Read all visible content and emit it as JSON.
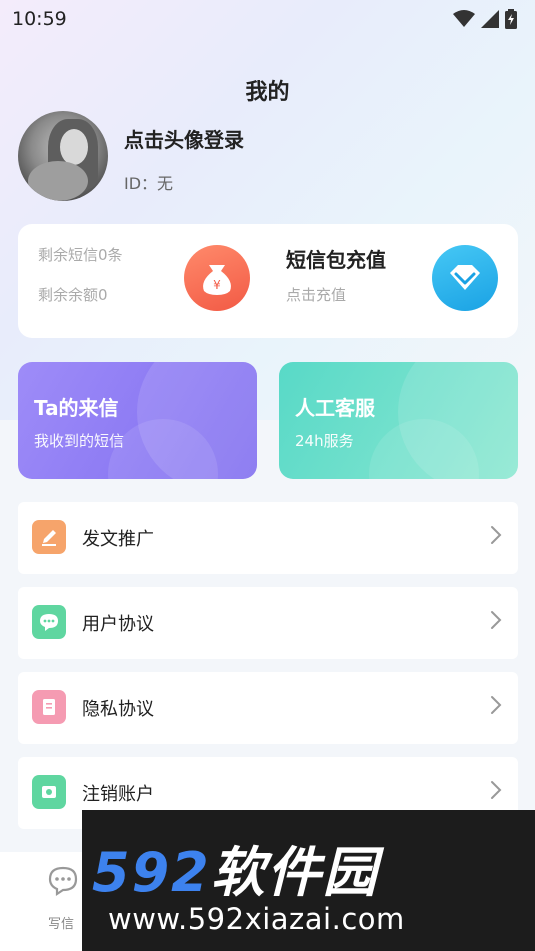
{
  "status": {
    "time": "10:59"
  },
  "page": {
    "title": "我的"
  },
  "profile": {
    "login_prompt": "点击头像登录",
    "id_line": "ID：无"
  },
  "balance": {
    "remaining_sms": "剩余短信0条",
    "remaining_amount": "剩余余额0",
    "money_symbol": "¥",
    "recharge_title": "短信包充值",
    "recharge_sub": "点击充值"
  },
  "tiles": [
    {
      "title": "Ta的来信",
      "subtitle": "我收到的短信"
    },
    {
      "title": "人工客服",
      "subtitle": "24h服务"
    }
  ],
  "menu": [
    {
      "label": "发文推广",
      "icon": "edit-icon",
      "color": "#f6a46b"
    },
    {
      "label": "用户协议",
      "icon": "chat-icon",
      "color": "#5fd6a0"
    },
    {
      "label": "隐私协议",
      "icon": "document-icon",
      "color": "#f59bb2"
    },
    {
      "label": "注销账户",
      "icon": "account-icon",
      "color": "#5fd6a0"
    }
  ],
  "bottom_nav": {
    "write_label": "写信"
  },
  "watermark": {
    "brand_num": "592",
    "brand_cn": "软件园",
    "url": "www.592xiazai.com"
  },
  "colors": {
    "tile_left": "#8a78f4",
    "tile_right": "#6fdfcb",
    "money_icon": "#f6674f",
    "diamond_icon": "#2db4ee",
    "watermark_blue": "#3d82ee"
  }
}
